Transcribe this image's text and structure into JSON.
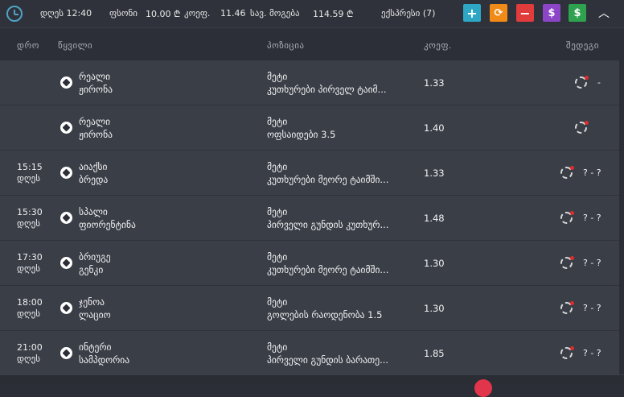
{
  "topbar": {
    "time_label": "დღეს 12:40",
    "bet_label": "ფსონი",
    "bet_value": "10.00 ₾",
    "coef_label": "კოეფ.",
    "coef_value": "11.46",
    "win_label": "სავ. მოგება",
    "win_value": "114.59 ₾",
    "express_label": "ექსპრესი (7)",
    "add_label": "+",
    "refresh_label": "⟳",
    "remove_label": "−",
    "dollar_label": "$",
    "dollar2_label": "$",
    "collapse_label": "︿"
  },
  "headers": {
    "time": "დრო",
    "pair": "წყვილი",
    "position": "პოზიცია",
    "coef": "კოეფ.",
    "result": "შედეგი"
  },
  "rows": [
    {
      "time": "",
      "day": "",
      "team1": "რეალი",
      "team2": "ჟირონა",
      "pos_line1": "მეტი",
      "pos_line2": "კუთხურები პირველ ტაიმ...",
      "odds": "1.33",
      "score": "-"
    },
    {
      "time": "",
      "day": "",
      "team1": "რეალი",
      "team2": "ჟირონა",
      "pos_line1": "მეტი",
      "pos_line2": "ოფსაიდები 3.5",
      "odds": "1.40",
      "score": ""
    },
    {
      "time": "15:15",
      "day": "დღეს",
      "team1": "აიაქსი",
      "team2": "ბრედა",
      "pos_line1": "მეტი",
      "pos_line2": "კუთხურები მეორე ტაიმში...",
      "odds": "1.33",
      "score": "? - ?"
    },
    {
      "time": "15:30",
      "day": "დღეს",
      "team1": "სპალი",
      "team2": "ფიორენტინა",
      "pos_line1": "მეტი",
      "pos_line2": "პირველი გუნდის კუთხურ...",
      "odds": "1.48",
      "score": "? - ?"
    },
    {
      "time": "17:30",
      "day": "დღეს",
      "team1": "ბრიუგე",
      "team2": "გენკი",
      "pos_line1": "მეტი",
      "pos_line2": "კუთხურები მეორე ტაიმში...",
      "odds": "1.30",
      "score": "? - ?"
    },
    {
      "time": "18:00",
      "day": "დღეს",
      "team1": "ჯენოა",
      "team2": "ლაციო",
      "pos_line1": "მეტი",
      "pos_line2": "გოლების რაოდენობა 1.5",
      "odds": "1.30",
      "score": "? - ?"
    },
    {
      "time": "21:00",
      "day": "დღეს",
      "team1": "ინტერი",
      "team2": "სამპდორია",
      "pos_line1": "მეტი",
      "pos_line2": "პირველი გუნდის ბარათე...",
      "odds": "1.85",
      "score": "? - ?"
    }
  ]
}
